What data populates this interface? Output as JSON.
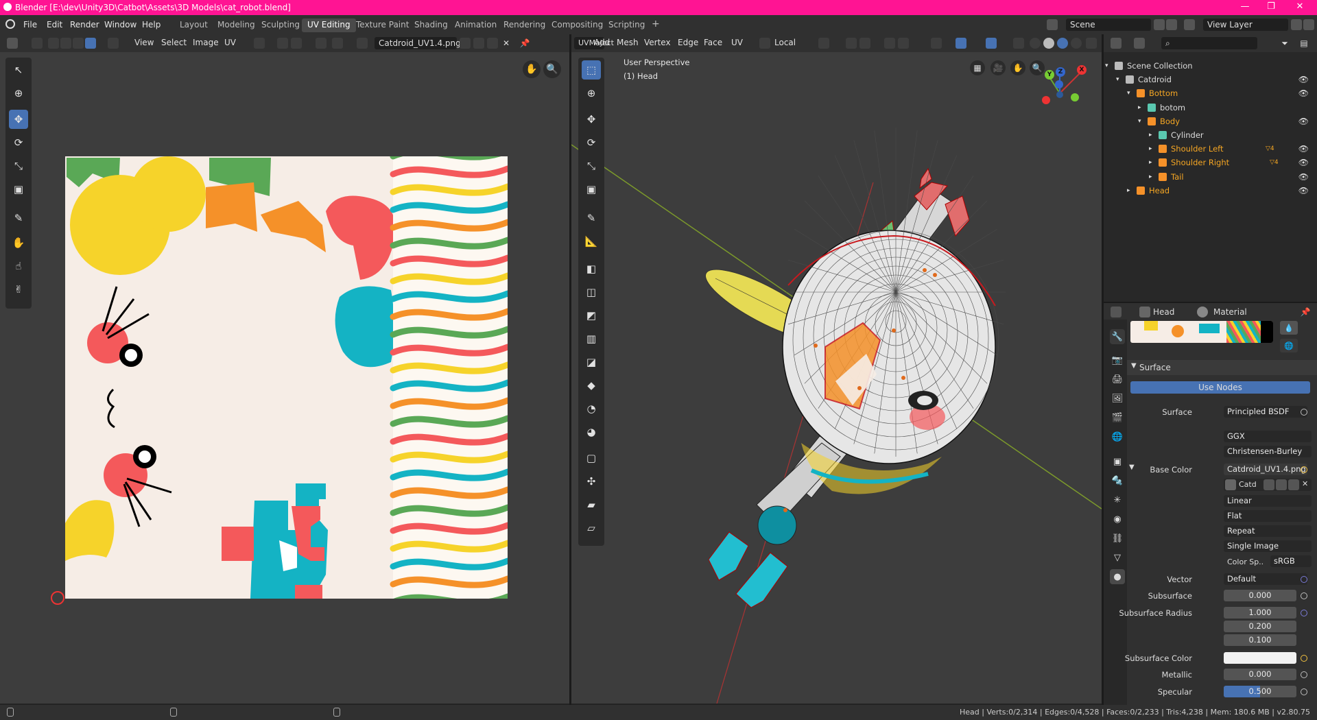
{
  "window": {
    "title": "Blender [E:\\dev\\Unity3D\\Catbot\\Assets\\3D Models\\cat_robot.blend]",
    "controls": [
      "—",
      "❐",
      "✕"
    ]
  },
  "menus": [
    "File",
    "Edit",
    "Render",
    "Window",
    "Help"
  ],
  "workspaces": {
    "tabs": [
      "Layout",
      "Modeling",
      "Sculpting",
      "UV Editing",
      "Texture Paint",
      "Shading",
      "Animation",
      "Rendering",
      "Compositing",
      "Scripting"
    ],
    "active": "UV Editing",
    "add": "+"
  },
  "scene": {
    "label": "Scene",
    "view_layer": "View Layer"
  },
  "uv_editor": {
    "menus": [
      "View",
      "Select",
      "Image",
      "UV"
    ],
    "image_name": "Catdroid_UV1.4.png"
  },
  "viewport": {
    "mode": "UVMaject",
    "menus": [
      "Add",
      "Mesh",
      "Vertex",
      "Edge",
      "Face",
      "UV"
    ],
    "orientation": "Local",
    "overlay_title": "User Perspective",
    "overlay_object": "(1) Head",
    "gizmo_labels": {
      "x": "X",
      "y": "Y",
      "z": "Z"
    }
  },
  "outliner": {
    "search_placeholder": "",
    "rows": [
      {
        "label": "Scene Collection",
        "indent": 0
      },
      {
        "label": "Catdroid",
        "indent": 1
      },
      {
        "label": "Bottom",
        "indent": 2
      },
      {
        "label": "botom",
        "indent": 3
      },
      {
        "label": "Body",
        "indent": 3
      },
      {
        "label": "Cylinder",
        "indent": 4
      },
      {
        "label": "Shoulder Left",
        "indent": 4
      },
      {
        "label": "Shoulder Right",
        "indent": 4
      },
      {
        "label": "Tail",
        "indent": 4
      },
      {
        "label": "Head",
        "indent": 2
      }
    ],
    "modifier_counts": [
      "4",
      "4"
    ]
  },
  "properties": {
    "object": "Head",
    "tab": "Material",
    "panel": "Surface",
    "use_nodes": "Use Nodes",
    "surface_label": "Surface",
    "surface_value": "Principled BSDF",
    "distribution": "GGX",
    "subsurface_method": "Christensen-Burley",
    "base_color_label": "Base Color",
    "base_color_value": "Catdroid_UV1.4.png",
    "image_short": "Catd",
    "interpolation": "Linear",
    "projection": "Flat",
    "extension": "Repeat",
    "source": "Single Image",
    "color_space_label": "Color Sp..",
    "color_space_value": "sRGB",
    "vector_label": "Vector",
    "vector_value": "Default",
    "subsurface_label": "Subsurface",
    "subsurface_value": "0.000",
    "subsurface_radius_label": "Subsurface Radius",
    "subsurface_radius": [
      "1.000",
      "0.200",
      "0.100"
    ],
    "subsurface_color_label": "Subsurface Color",
    "metallic_label": "Metallic",
    "metallic_value": "0.000",
    "specular_label": "Specular",
    "specular_value": "0.500",
    "specular_fraction": 0.5
  },
  "statusbar": {
    "text": "Head | Verts:0/2,314 | Edges:0/4,528 | Faces:0/2,233 | Tris:4,238 | Mem: 180.6 MB | v2.80.75"
  },
  "colors": {
    "title_bar": "#ff1493",
    "accent": "#4772b3",
    "selected_orange": "#f5a623",
    "texture_bg": "#f6ede6",
    "yellow": "#f6d32a",
    "green": "#5aa856",
    "orange": "#f59129",
    "coral": "#f4595b",
    "teal": "#14b3c4",
    "wire_red": "#c8191e"
  }
}
